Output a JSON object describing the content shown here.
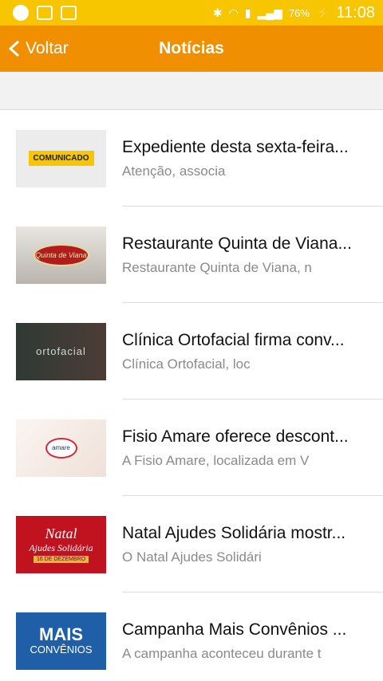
{
  "status_bar": {
    "battery": "76%",
    "time": "11:08"
  },
  "app_bar": {
    "back_label": "Voltar",
    "title": "Notícias"
  },
  "news": [
    {
      "title": "Expediente desta sexta-feira...",
      "snippet": "Atenção, associa",
      "thumb_text": "COMUNICADO"
    },
    {
      "title": "Restaurante Quinta de Viana...",
      "snippet": "Restaurante Quinta de Viana, n",
      "thumb_text": "Quinta de Viana"
    },
    {
      "title": "Clínica Ortofacial firma conv...",
      "snippet": "Clínica Ortofacial, loc",
      "thumb_text": "ortofacial"
    },
    {
      "title": "Fisio Amare oferece descont...",
      "snippet": "A Fisio Amare, localizada em V",
      "thumb_text": "amare"
    },
    {
      "title": "Natal Ajudes Solidária mostr...",
      "snippet": "O Natal Ajudes Solidári",
      "thumb_text_1": "Natal",
      "thumb_text_2": "Ajudes Solidária",
      "thumb_text_3": "16 DE DEZEMBRO"
    },
    {
      "title": "Campanha Mais Convênios ...",
      "snippet": "A campanha aconteceu durante t",
      "thumb_text_1": "MAIS",
      "thumb_text_2": "CONVÊNIOS"
    }
  ],
  "colors": {
    "status_bar": "#f7c600",
    "app_bar": "#f09000"
  }
}
